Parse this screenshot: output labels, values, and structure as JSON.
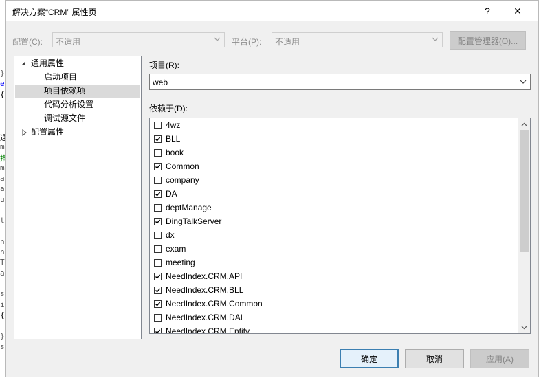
{
  "background_code": [
    "}",
    "e",
    "{",
    "",
    "",
    "",
    "通",
    "m",
    "描",
    "m",
    "a",
    "a",
    "u",
    "",
    "t",
    "",
    "n",
    "n",
    "T",
    "a",
    "",
    "s",
    "i",
    "{",
    "",
    "}",
    "s"
  ],
  "dialog": {
    "title": "解决方案“CRM” 属性页",
    "help_label": "?",
    "close_label": "✕"
  },
  "toolbar": {
    "config_label": "配置(C):",
    "config_value": "不适用",
    "platform_label": "平台(P):",
    "platform_value": "不适用",
    "config_manager_label": "配置管理器(O)..."
  },
  "tree": {
    "common_props": "通用属性",
    "children": [
      "启动项目",
      "项目依赖项",
      "代码分析设置",
      "调试源文件"
    ],
    "selected_index": 1,
    "config_props": "配置属性"
  },
  "project": {
    "label": "项目(R):",
    "value": "web"
  },
  "depends": {
    "label": "依赖于(D):",
    "items": [
      {
        "name": "4wz",
        "checked": false
      },
      {
        "name": "BLL",
        "checked": true
      },
      {
        "name": "book",
        "checked": false
      },
      {
        "name": "Common",
        "checked": true
      },
      {
        "name": "company",
        "checked": false
      },
      {
        "name": "DA",
        "checked": true
      },
      {
        "name": "deptManage",
        "checked": false
      },
      {
        "name": "DingTalkServer",
        "checked": true
      },
      {
        "name": "dx",
        "checked": false
      },
      {
        "name": "exam",
        "checked": false
      },
      {
        "name": "meeting",
        "checked": false
      },
      {
        "name": "NeedIndex.CRM.API",
        "checked": true
      },
      {
        "name": "NeedIndex.CRM.BLL",
        "checked": true
      },
      {
        "name": "NeedIndex.CRM.Common",
        "checked": true
      },
      {
        "name": "NeedIndex.CRM.DAL",
        "checked": false
      },
      {
        "name": "NeedIndex.CRM.Entity",
        "checked": true
      }
    ]
  },
  "buttons": {
    "ok": "确定",
    "cancel": "取消",
    "apply": "应用(A)"
  },
  "colors": {
    "dialog_bg": "#f0f0f0",
    "selection": "#dadada",
    "default_border": "#3c7fb1",
    "code_blue": "#0000ff",
    "code_green": "#008000"
  }
}
